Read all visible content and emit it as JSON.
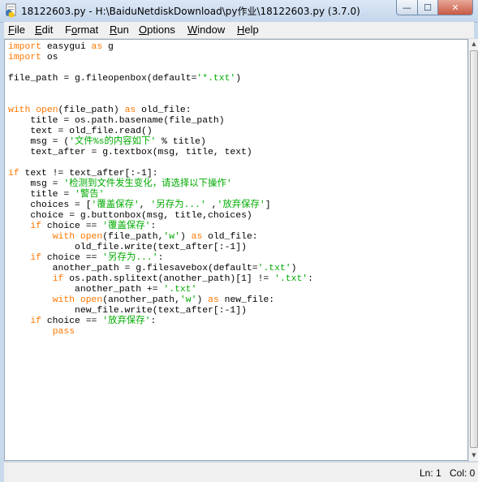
{
  "window": {
    "title": "18122603.py - H:\\BaiduNetdiskDownload\\py作业\\18122603.py (3.7.0)",
    "icon": "python-idle-icon",
    "controls": {
      "minimize": "—",
      "maximize": "☐",
      "close": "✕"
    }
  },
  "menu": {
    "items": [
      {
        "u": "F",
        "rest": "ile"
      },
      {
        "u": "E",
        "rest": "dit"
      },
      {
        "u": "",
        "pre": "F",
        "mid": "o",
        "rest": "rmat"
      },
      {
        "u": "R",
        "rest": "un"
      },
      {
        "u": "O",
        "rest": "ptions"
      },
      {
        "u": "W",
        "rest": "indow"
      },
      {
        "u": "H",
        "rest": "elp"
      }
    ]
  },
  "colors": {
    "keyword": "#ff7700",
    "string": "#00aa00",
    "text": "#000000"
  },
  "code_lines": [
    [
      [
        "k",
        "import"
      ],
      [
        "t",
        " easygui "
      ],
      [
        "k",
        "as"
      ],
      [
        "t",
        " g"
      ]
    ],
    [
      [
        "k",
        "import"
      ],
      [
        "t",
        " os"
      ]
    ],
    [],
    [
      [
        "t",
        "file_path = g.fileopenbox(default="
      ],
      [
        "s",
        "'*.txt'"
      ],
      [
        "t",
        ")"
      ]
    ],
    [],
    [],
    [
      [
        "k",
        "with"
      ],
      [
        "t",
        " "
      ],
      [
        "k",
        "open"
      ],
      [
        "t",
        "(file_path) "
      ],
      [
        "k",
        "as"
      ],
      [
        "t",
        " old_file:"
      ]
    ],
    [
      [
        "t",
        "    title = os.path.basename(file_path)"
      ]
    ],
    [
      [
        "t",
        "    text = old_file.read()"
      ]
    ],
    [
      [
        "t",
        "    msg = ("
      ],
      [
        "s",
        "'文件%s的内容如下'"
      ],
      [
        "t",
        " % title)"
      ]
    ],
    [
      [
        "t",
        "    text_after = g.textbox(msg, title, text)"
      ]
    ],
    [],
    [
      [
        "k",
        "if"
      ],
      [
        "t",
        " text != text_after[:-1]:"
      ]
    ],
    [
      [
        "t",
        "    msg = "
      ],
      [
        "s",
        "'检测到文件发生变化，请选择以下操作'"
      ]
    ],
    [
      [
        "t",
        "    title = "
      ],
      [
        "s",
        "'警告'"
      ]
    ],
    [
      [
        "t",
        "    choices = ["
      ],
      [
        "s",
        "'覆盖保存'"
      ],
      [
        "t",
        ", "
      ],
      [
        "s",
        "'另存为...'"
      ],
      [
        "t",
        " ,"
      ],
      [
        "s",
        "'放弃保存'"
      ],
      [
        "t",
        "]"
      ]
    ],
    [
      [
        "t",
        "    choice = g.buttonbox(msg, title,choices)"
      ]
    ],
    [
      [
        "t",
        "    "
      ],
      [
        "k",
        "if"
      ],
      [
        "t",
        " choice == "
      ],
      [
        "s",
        "'覆盖保存'"
      ],
      [
        "t",
        ":"
      ]
    ],
    [
      [
        "t",
        "        "
      ],
      [
        "k",
        "with"
      ],
      [
        "t",
        " "
      ],
      [
        "k",
        "open"
      ],
      [
        "t",
        "(file_path,"
      ],
      [
        "s",
        "'w'"
      ],
      [
        "t",
        ") "
      ],
      [
        "k",
        "as"
      ],
      [
        "t",
        " old_file:"
      ]
    ],
    [
      [
        "t",
        "            old_file.write(text_after[:-1])"
      ]
    ],
    [
      [
        "t",
        "    "
      ],
      [
        "k",
        "if"
      ],
      [
        "t",
        " choice == "
      ],
      [
        "s",
        "'另存为...'"
      ],
      [
        "t",
        ":"
      ]
    ],
    [
      [
        "t",
        "        another_path = g.filesavebox(default="
      ],
      [
        "s",
        "'.txt'"
      ],
      [
        "t",
        ")"
      ]
    ],
    [
      [
        "t",
        "        "
      ],
      [
        "k",
        "if"
      ],
      [
        "t",
        " os.path.splitext(another_path)[1] != "
      ],
      [
        "s",
        "'.txt'"
      ],
      [
        "t",
        ":"
      ]
    ],
    [
      [
        "t",
        "            another_path += "
      ],
      [
        "s",
        "'.txt'"
      ]
    ],
    [
      [
        "t",
        "        "
      ],
      [
        "k",
        "with"
      ],
      [
        "t",
        " "
      ],
      [
        "k",
        "open"
      ],
      [
        "t",
        "(another_path,"
      ],
      [
        "s",
        "'w'"
      ],
      [
        "t",
        ") "
      ],
      [
        "k",
        "as"
      ],
      [
        "t",
        " new_file:"
      ]
    ],
    [
      [
        "t",
        "            new_file.write(text_after[:-1])"
      ]
    ],
    [
      [
        "t",
        "    "
      ],
      [
        "k",
        "if"
      ],
      [
        "t",
        " choice == "
      ],
      [
        "s",
        "'放弃保存'"
      ],
      [
        "t",
        ":"
      ]
    ],
    [
      [
        "t",
        "        "
      ],
      [
        "k",
        "pass"
      ]
    ]
  ],
  "status": {
    "line": "Ln: 1",
    "col": "Col: 0"
  }
}
